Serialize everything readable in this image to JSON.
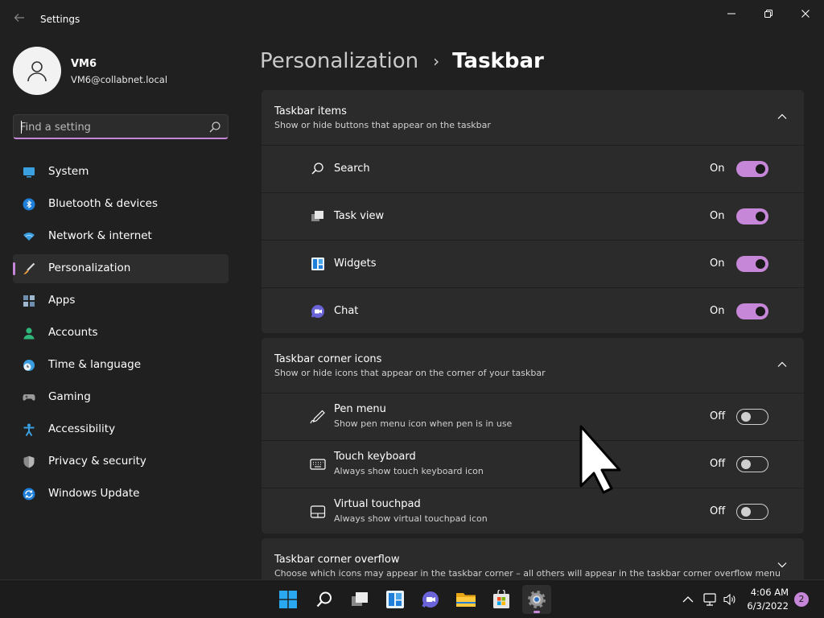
{
  "window": {
    "title": "Settings"
  },
  "profile": {
    "name": "VM6",
    "email": "VM6@collabnet.local"
  },
  "search": {
    "placeholder": "Find a setting"
  },
  "sidebar": {
    "items": [
      {
        "label": "System",
        "icon": "system-icon",
        "active": false
      },
      {
        "label": "Bluetooth & devices",
        "icon": "bluetooth-icon",
        "active": false
      },
      {
        "label": "Network & internet",
        "icon": "network-icon",
        "active": false
      },
      {
        "label": "Personalization",
        "icon": "brush-icon",
        "active": true
      },
      {
        "label": "Apps",
        "icon": "apps-icon",
        "active": false
      },
      {
        "label": "Accounts",
        "icon": "accounts-icon",
        "active": false
      },
      {
        "label": "Time & language",
        "icon": "globe-clock-icon",
        "active": false
      },
      {
        "label": "Gaming",
        "icon": "gamepad-icon",
        "active": false
      },
      {
        "label": "Accessibility",
        "icon": "accessibility-icon",
        "active": false
      },
      {
        "label": "Privacy & security",
        "icon": "shield-icon",
        "active": false
      },
      {
        "label": "Windows Update",
        "icon": "update-icon",
        "active": false
      }
    ]
  },
  "breadcrumb": {
    "parent": "Personalization",
    "separator": "›",
    "current": "Taskbar"
  },
  "sections": [
    {
      "title": "Taskbar items",
      "description": "Show or hide buttons that appear on the taskbar",
      "expanded": true,
      "rows": [
        {
          "label": "Search",
          "state": "On",
          "icon": "search-icon"
        },
        {
          "label": "Task view",
          "state": "On",
          "icon": "task-view-icon"
        },
        {
          "label": "Widgets",
          "state": "On",
          "icon": "widgets-icon"
        },
        {
          "label": "Chat",
          "state": "On",
          "icon": "chat-icon"
        }
      ]
    },
    {
      "title": "Taskbar corner icons",
      "description": "Show or hide icons that appear on the corner of your taskbar",
      "expanded": true,
      "rows": [
        {
          "label": "Pen menu",
          "sub": "Show pen menu icon when pen is in use",
          "state": "Off",
          "icon": "pen-icon"
        },
        {
          "label": "Touch keyboard",
          "sub": "Always show touch keyboard icon",
          "state": "Off",
          "icon": "keyboard-icon"
        },
        {
          "label": "Virtual touchpad",
          "sub": "Always show virtual touchpad icon",
          "state": "Off",
          "icon": "touchpad-icon"
        }
      ]
    },
    {
      "title": "Taskbar corner overflow",
      "description": "Choose which icons may appear in the taskbar corner – all others will appear in the taskbar corner overflow menu",
      "expanded": false
    }
  ],
  "taskbar": {
    "apps": [
      "start-icon",
      "search-icon",
      "task-view-icon",
      "widgets-icon",
      "chat-icon",
      "file-explorer-icon",
      "store-icon",
      "settings-icon"
    ],
    "time": "4:06 AM",
    "date": "6/3/2022",
    "notifications": "2"
  },
  "colors": {
    "accent": "#c687d8",
    "background": "#202020",
    "card": "#2b2b2b"
  }
}
